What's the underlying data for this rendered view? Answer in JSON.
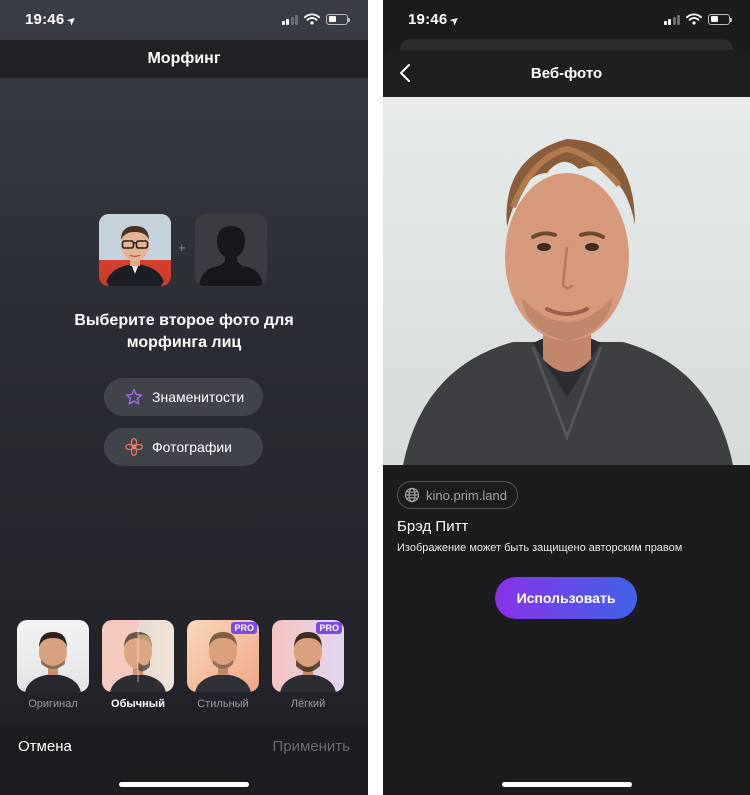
{
  "status_bar": {
    "time": "19:46"
  },
  "left_screen": {
    "title": "Морфинг",
    "prompt_line1": "Выберите второе фото для",
    "prompt_line2": "морфинга лиц",
    "celebrities_label": "Знаменитости",
    "photos_label": "Фотографии",
    "styles": [
      {
        "label": "Оригинал",
        "pro": false,
        "selected": false
      },
      {
        "label": "Обычный",
        "pro": false,
        "selected": true
      },
      {
        "label": "Стильный",
        "pro": true,
        "badge": "PRO",
        "selected": false
      },
      {
        "label": "Лёгкий",
        "pro": true,
        "badge": "PRO",
        "selected": false
      }
    ],
    "cancel_label": "Отмена",
    "apply_label": "Применить"
  },
  "right_screen": {
    "title": "Веб-фото",
    "source_domain": "kino.prim.land",
    "person_name": "Брэд Питт",
    "copyright_notice": "Изображение может быть защищено авторским правом",
    "use_label": "Использовать"
  },
  "colors": {
    "accent_purple": "#8a32e6",
    "accent_blue": "#3f63e8",
    "pro_badge": "#7b4ae8",
    "dark_background": "#1c1c1e"
  },
  "icons": {
    "celebrities": "star-icon",
    "photos": "flower-icon",
    "source": "globe-icon",
    "back": "chevron-left-icon"
  }
}
